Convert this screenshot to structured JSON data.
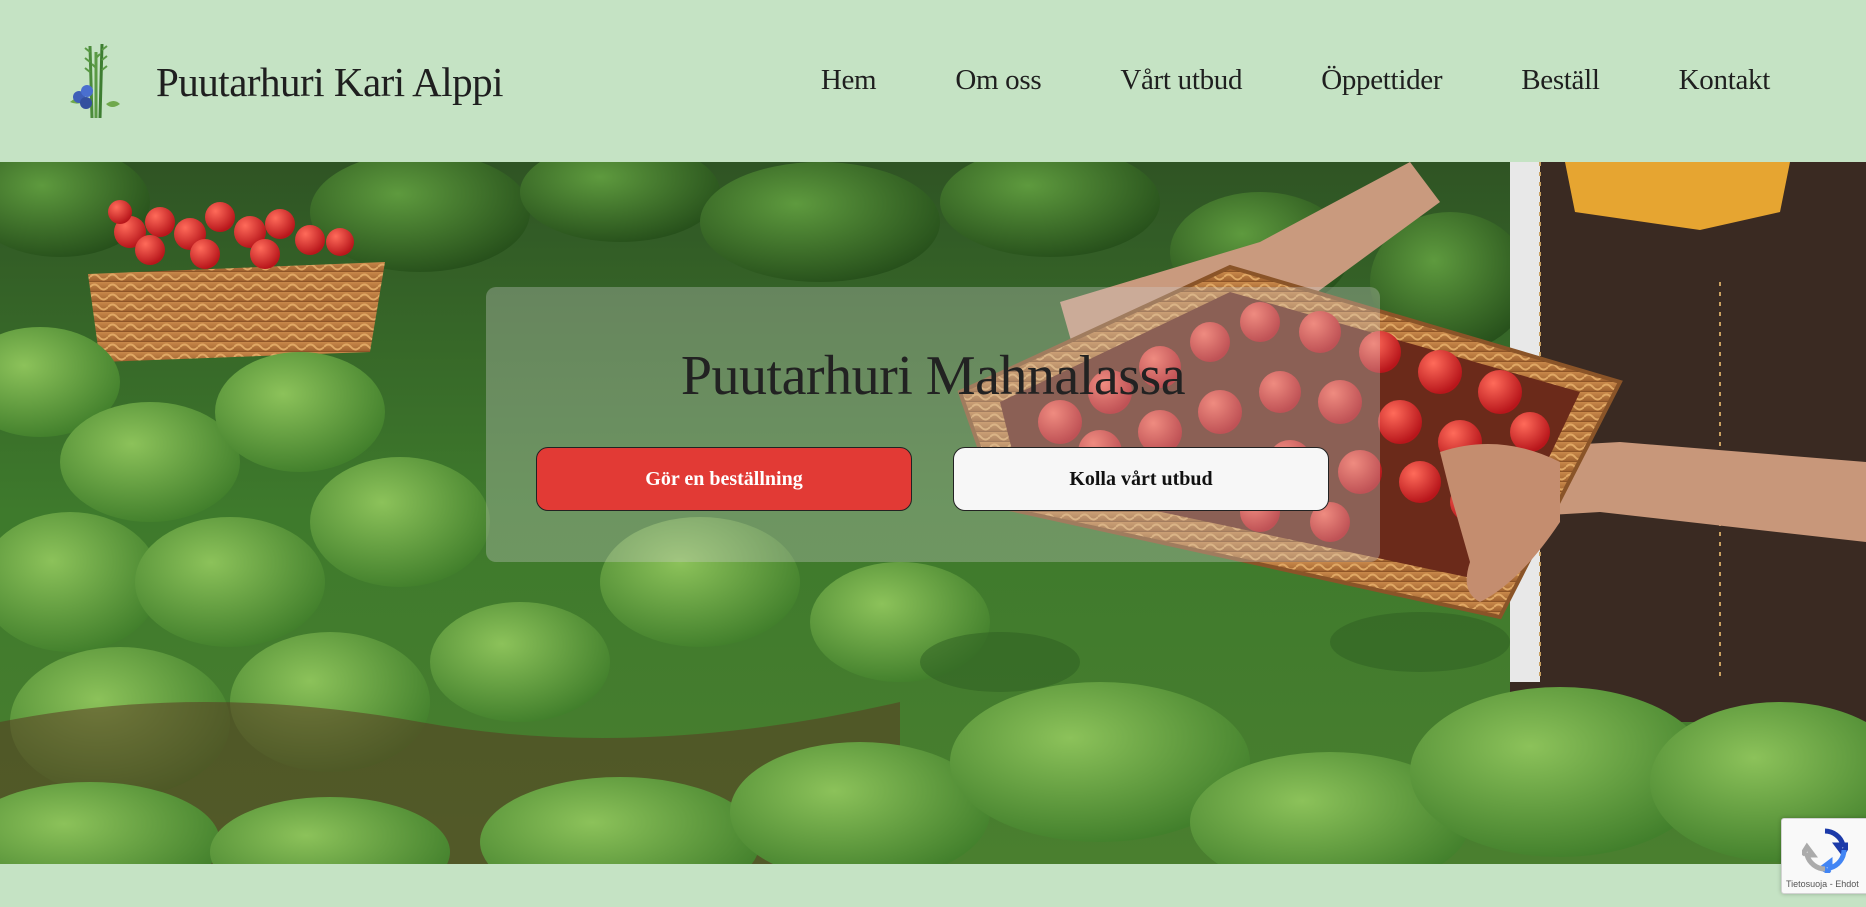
{
  "header": {
    "site_title": "Puutarhuri Kari Alppi",
    "nav": [
      {
        "label": "Hem"
      },
      {
        "label": "Om oss"
      },
      {
        "label": "Vårt utbud"
      },
      {
        "label": "Öppettider"
      },
      {
        "label": "Beställ"
      },
      {
        "label": "Kontakt"
      }
    ]
  },
  "hero": {
    "title": "Puutarhuri Mahnalassa",
    "primary_button": "Gör en beställning",
    "secondary_button": "Kolla vårt utbud"
  },
  "recaptcha": {
    "links": "Tietosuoja - Ehdot"
  },
  "colors": {
    "background": "#c5e3c4",
    "primary_button": "#e23a35",
    "secondary_button": "#f7f7f7",
    "text": "#1f1f1f"
  },
  "icons": [
    "asparagus-blueberry-logo-icon",
    "recaptcha-icon"
  ]
}
